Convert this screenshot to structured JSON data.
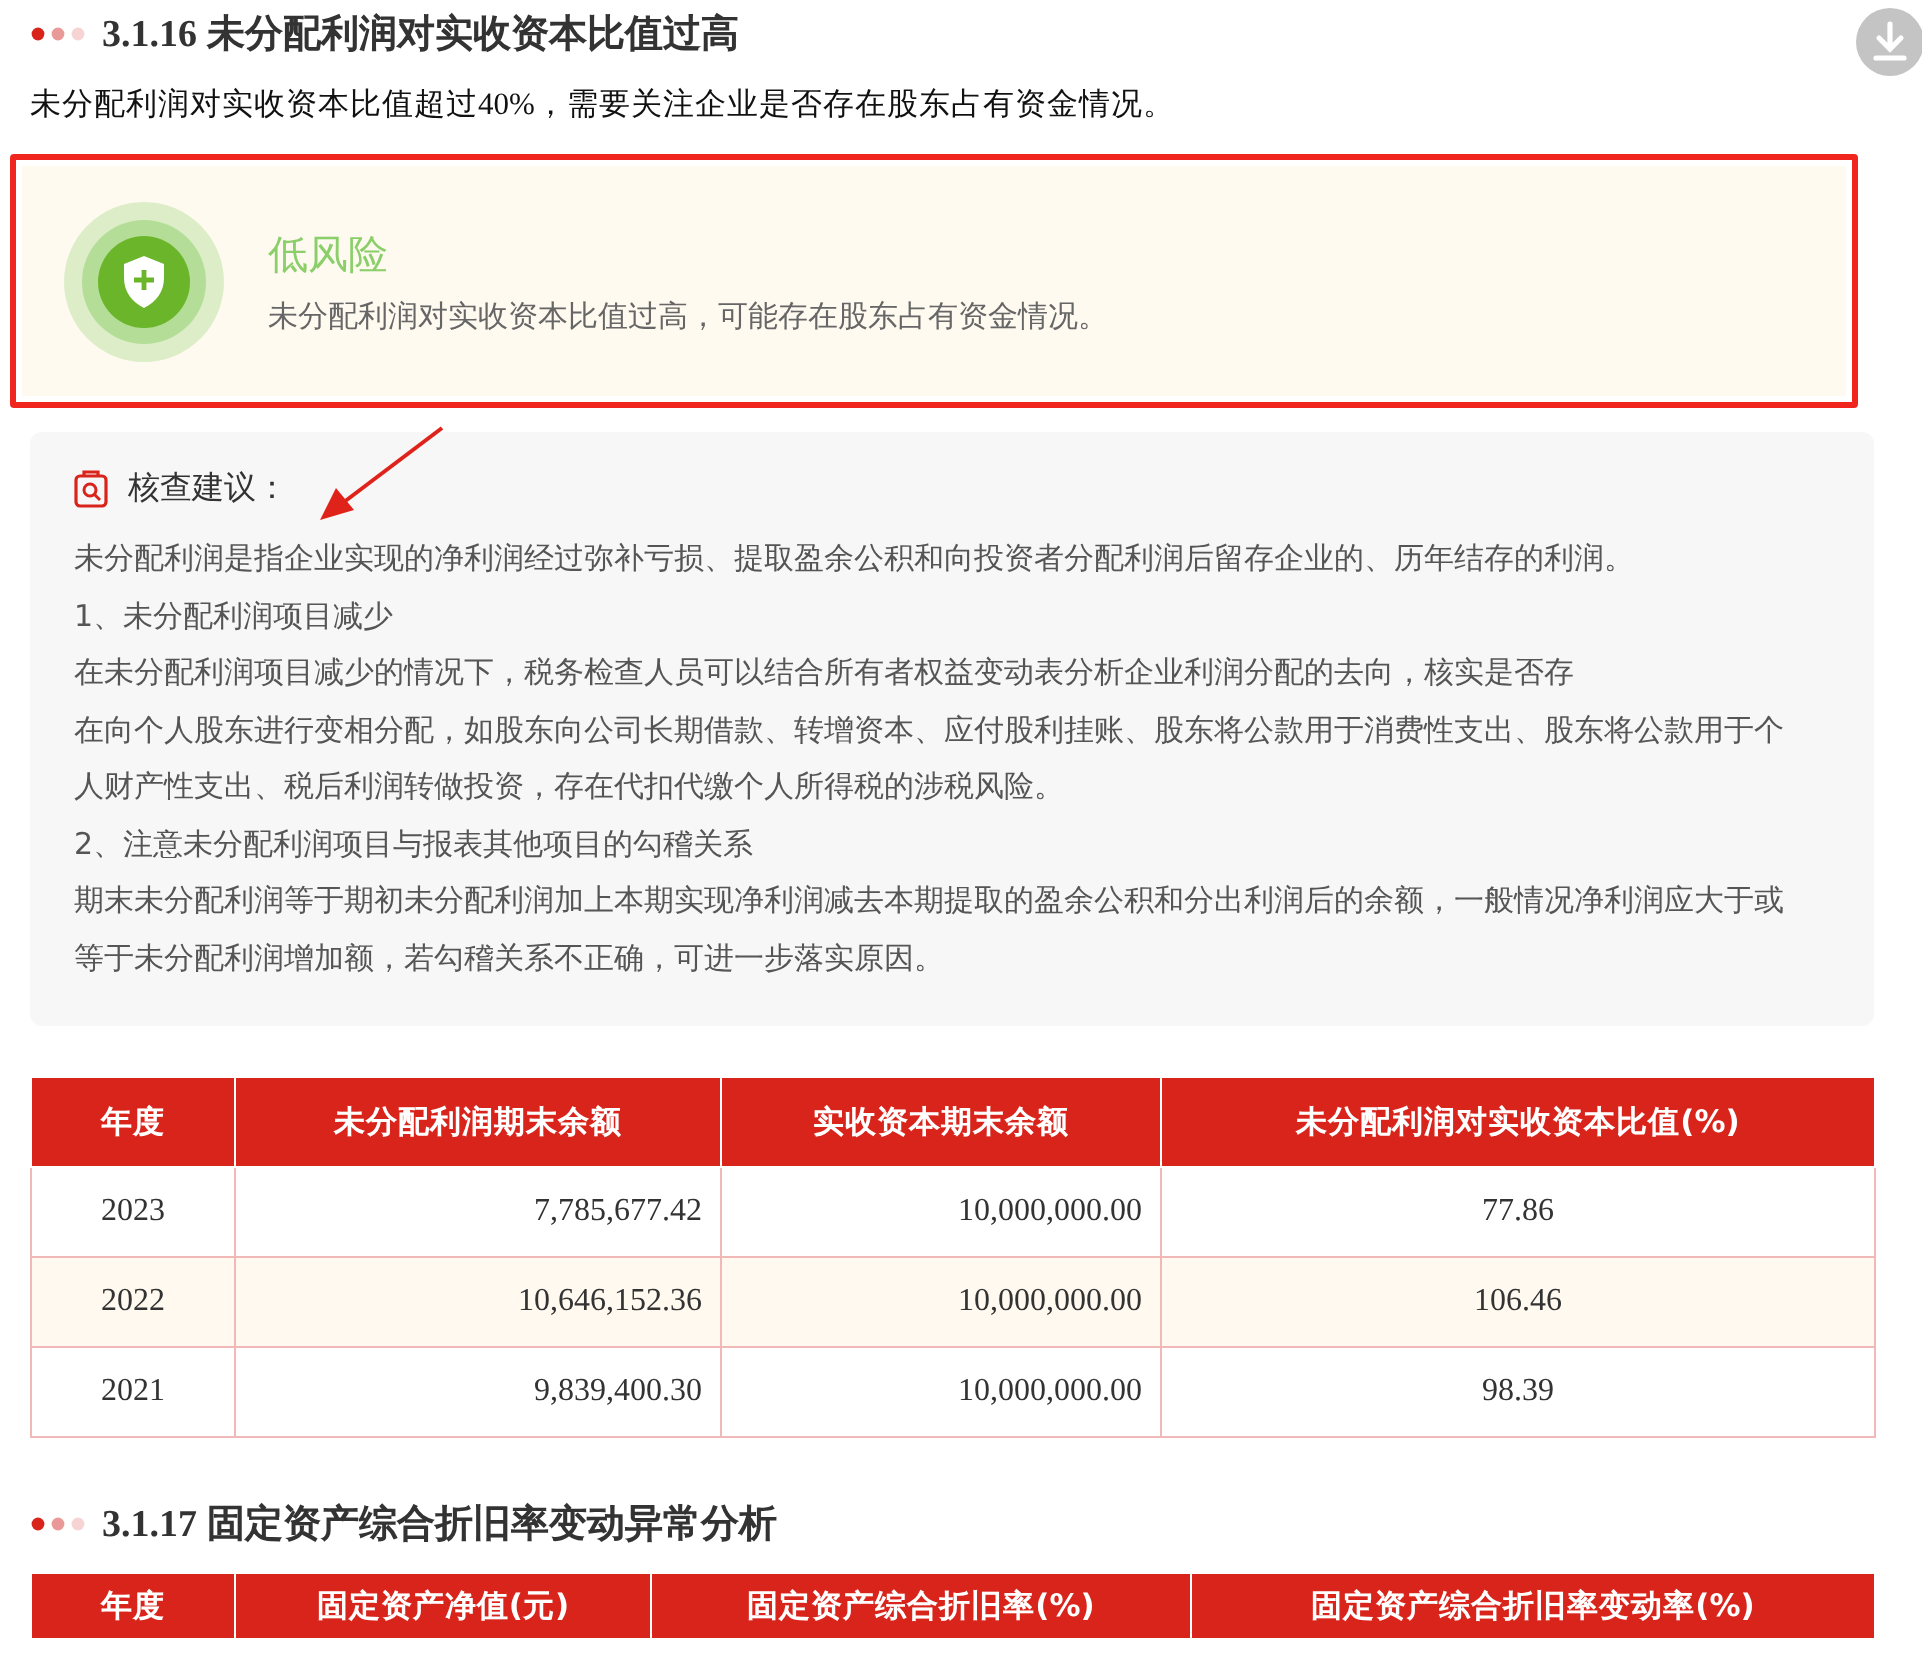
{
  "sections": [
    {
      "number": "3.1.16",
      "title": "未分配利润对实收资本比值过高",
      "summary": "未分配利润对实收资本比值超过40%，需要关注企业是否存在股东占有资金情况。",
      "risk": {
        "kind": "low",
        "label": "低风险",
        "description": "未分配利润对实收资本比值过高，可能存在股东占有资金情况。",
        "highlighted": true
      },
      "advice": {
        "title": "核查建议：",
        "paragraphs": [
          "未分配利润是指企业实现的净利润经过弥补亏损、提取盈余公积和向投资者分配利润后留存企业的、历年结存的利润。",
          "1、未分配利润项目减少",
          "在未分配利润项目减少的情况下，税务检查人员可以结合所有者权益变动表分析企业利润分配的去向，核实是否存",
          "在向个人股东进行变相分配，如股东向公司长期借款、转增资本、应付股利挂账、股东将公款用于消费性支出、股东将公款用于个人财产性支出、税后利润转做投资，存在代扣代缴个人所得税的涉税风险。",
          "2、注意未分配利润项目与报表其他项目的勾稽关系",
          "期末未分配利润等于期初未分配利润加上本期实现净利润减去本期提取的盈余公积和分出利润后的余额，一般情况净利润应大于或等于未分配利润增加额，若勾稽关系不正确，可进一步落实原因。"
        ]
      },
      "table": {
        "columns": [
          "年度",
          "未分配利润期末余额",
          "实收资本期末余额",
          "未分配利润对实收资本比值(%)"
        ],
        "rows": [
          [
            "2023",
            "7,785,677.42",
            "10,000,000.00",
            "77.86"
          ],
          [
            "2022",
            "10,646,152.36",
            "10,000,000.00",
            "106.46"
          ],
          [
            "2021",
            "9,839,400.30",
            "10,000,000.00",
            "98.39"
          ]
        ]
      }
    },
    {
      "number": "3.1.17",
      "title": "固定资产综合折旧率变动异常分析",
      "table": {
        "columns": [
          "年度",
          "固定资产净值(元)",
          "固定资产综合折旧率(%)",
          "固定资产综合折旧率变动率(%)"
        ]
      }
    }
  ]
}
